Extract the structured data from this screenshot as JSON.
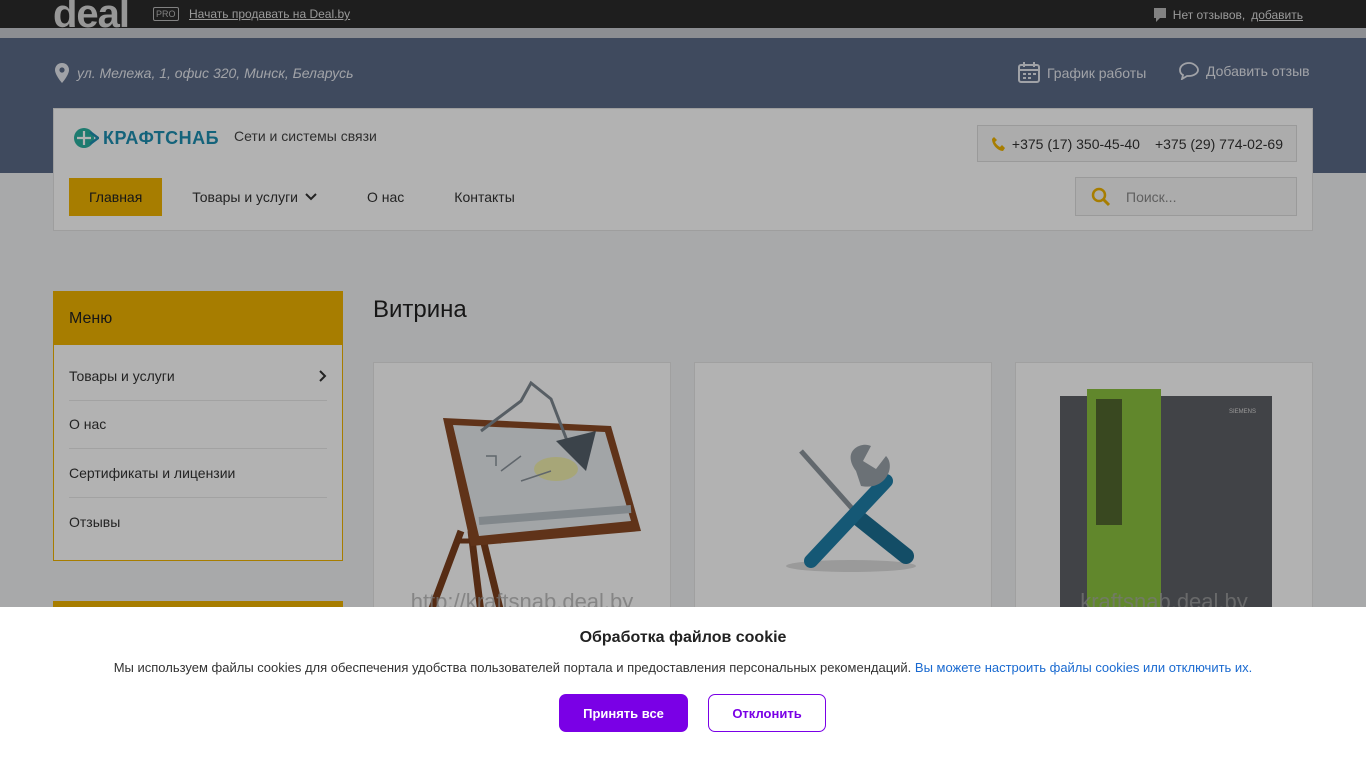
{
  "topbar": {
    "logo": "deal",
    "pro_badge": "PRO",
    "sell_link": "Начать продавать на Deal.by",
    "reviews_text": "Нет отзывов,",
    "reviews_add": "добавить"
  },
  "band": {
    "address": "ул. Мележа, 1, офис 320, Минск, Беларусь",
    "schedule": "График работы",
    "add_review": "Добавить отзыв"
  },
  "header": {
    "brand": "КРАФТСНАБ",
    "tagline": "Сети и системы связи",
    "phone1": "+375 (17) 350-45-40",
    "phone2": "+375 (29) 774-02-69",
    "search_placeholder": "Поиск..."
  },
  "nav": [
    {
      "label": "Главная",
      "active": true
    },
    {
      "label": "Товары и услуги",
      "dropdown": true
    },
    {
      "label": "О нас"
    },
    {
      "label": "Контакты"
    }
  ],
  "sidebar": {
    "title": "Меню",
    "items": [
      {
        "label": "Товары и услуги",
        "arrow": true
      },
      {
        "label": "О нас"
      },
      {
        "label": "Сертификаты и лицензии"
      },
      {
        "label": "Отзывы"
      }
    ]
  },
  "main": {
    "title": "Витрина",
    "cards": [
      {
        "watermark": "http://kraftsnab.deal.by",
        "icon": "drafting-table-image"
      },
      {
        "watermark": "",
        "icon": "tools-image"
      },
      {
        "watermark": "kraftsnab.deal.by",
        "icon": "siemens-cabinet-image",
        "brand": "SIEMENS"
      }
    ]
  },
  "cookie": {
    "title": "Обработка файлов cookie",
    "text": "Мы используем файлы cookies для обеспечения удобства пользователей портала и предоставления персональных рекомендаций.",
    "link": "Вы можете настроить файлы cookies или отключить их.",
    "accept": "Принять все",
    "decline": "Отклонить"
  },
  "colors": {
    "accent": "#f0b400",
    "band": "#5b6a87",
    "cookie_button": "#7a00e6",
    "link": "#1a6ad0"
  }
}
